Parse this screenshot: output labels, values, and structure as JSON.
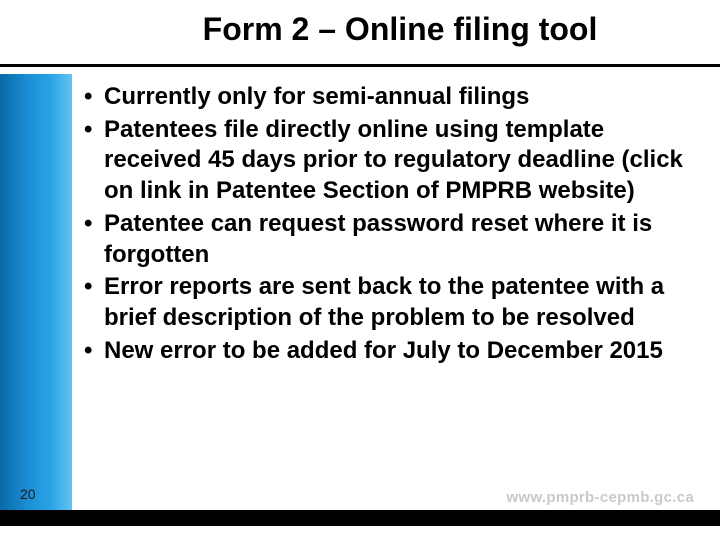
{
  "slide": {
    "title": "Form 2 – Online filing tool",
    "bullets": [
      "Currently only for semi-annual filings",
      "Patentees file directly online using template received 45 days prior to regulatory deadline (click on link in Patentee Section of PMPRB website)",
      "Patentee can request password reset where it is forgotten",
      "Error reports are sent back to the patentee with a brief description of the problem to be resolved",
      "New error to be added for July to December 2015"
    ],
    "page_number": "20",
    "footer_url": "www.pmprb-cepmb.gc.ca"
  }
}
